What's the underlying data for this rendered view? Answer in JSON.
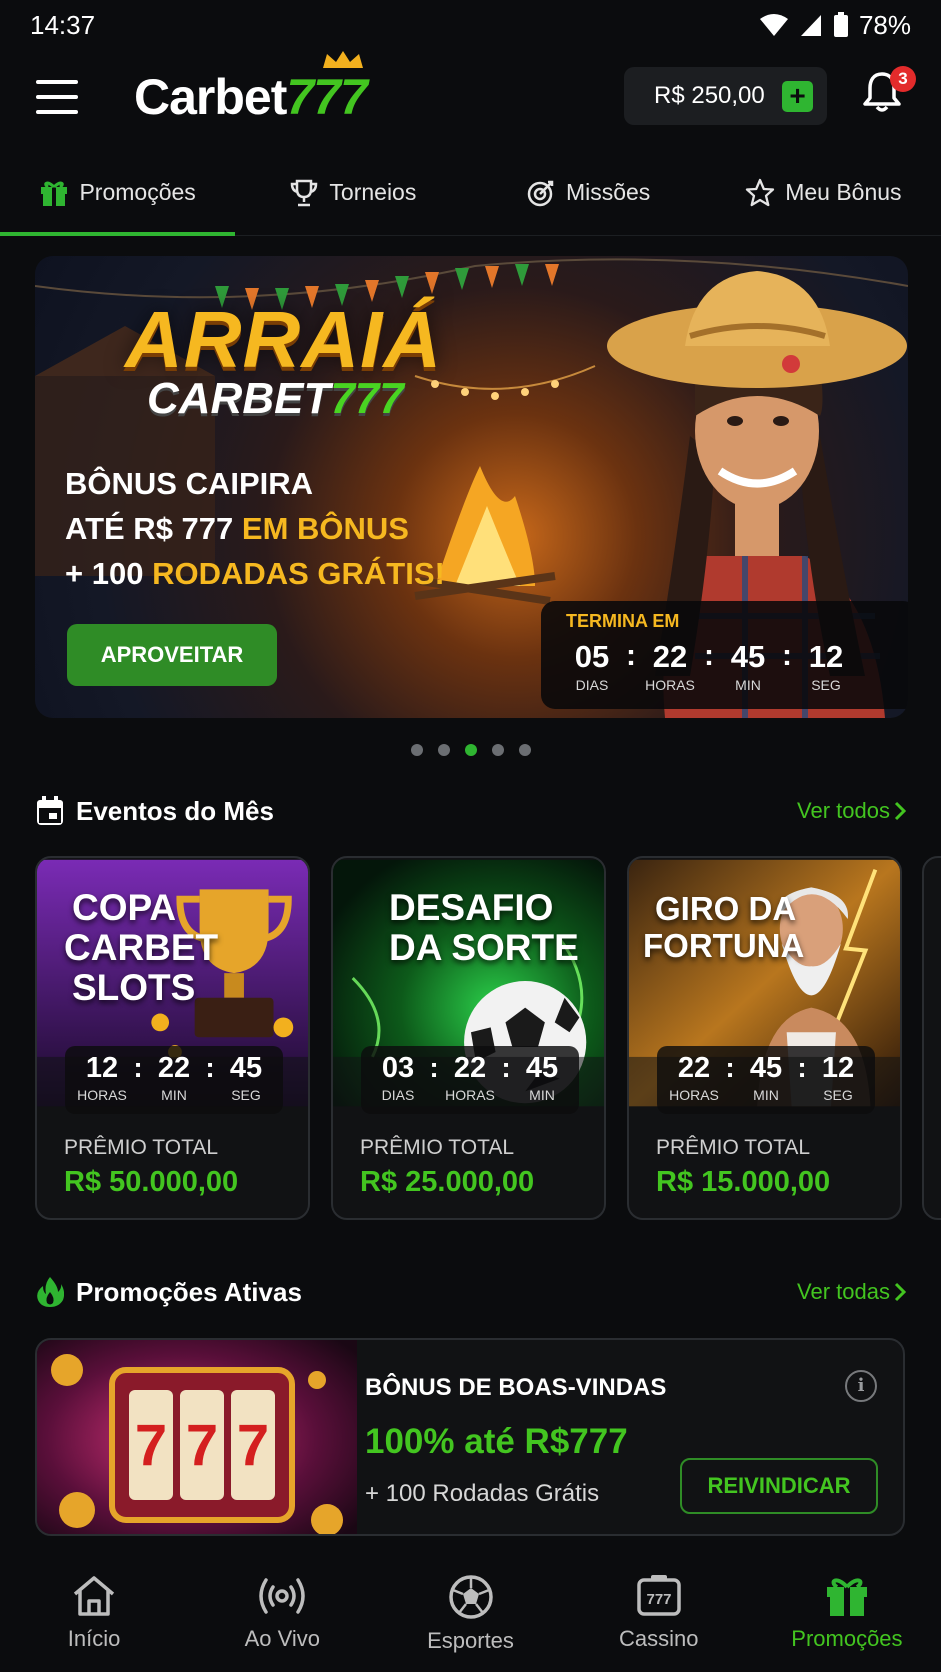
{
  "status_bar": {
    "time": "14:37",
    "battery": "78%"
  },
  "header": {
    "logo_word": "Carbet",
    "logo_num": "777",
    "balance": "R$ 250,00",
    "notification_count": "3"
  },
  "tabs": [
    {
      "label": "Promoções",
      "icon": "gift-icon",
      "active": true
    },
    {
      "label": "Torneios",
      "icon": "trophy-icon",
      "active": false
    },
    {
      "label": "Missões",
      "icon": "target-icon",
      "active": false
    },
    {
      "label": "Meu Bônus",
      "icon": "star-icon",
      "active": false
    }
  ],
  "banner": {
    "headline": "ARRAIÁ",
    "brand_word": "CARBET",
    "brand_num": "777",
    "line1": "BÔNUS CAIPIRA",
    "line2a": "ATÉ R$ 777 ",
    "line2b": "EM BÔNUS",
    "line3a": "+ 100 ",
    "line3b": "RODADAS GRÁTIS!",
    "cta": "APROVEITAR",
    "countdown": {
      "label": "TERMINA EM",
      "days": "05",
      "days_label": "DIAS",
      "hours": "22",
      "hours_label": "HORAS",
      "min": "45",
      "min_label": "MIN",
      "sec": "12",
      "sec_label": "SEG"
    },
    "slide_count": 5,
    "active_slide": 3
  },
  "events_section": {
    "title": "Eventos do Mês",
    "see_all": "Ver todos"
  },
  "events": [
    {
      "title_lines": [
        "COPA",
        "CARBET",
        "SLOTS"
      ],
      "timer": [
        {
          "value": "12",
          "unit": "HORAS"
        },
        {
          "value": "22",
          "unit": "MIN"
        },
        {
          "value": "45",
          "unit": "SEG"
        }
      ],
      "prize_label": "PRÊMIO TOTAL",
      "prize_value": "R$ 50.000,00"
    },
    {
      "title_lines": [
        "DESAFIO",
        "DA SORTE"
      ],
      "timer": [
        {
          "value": "03",
          "unit": "DIAS"
        },
        {
          "value": "22",
          "unit": "HORAS"
        },
        {
          "value": "45",
          "unit": "MIN"
        }
      ],
      "prize_label": "PRÊMIO TOTAL",
      "prize_value": "R$ 25.000,00"
    },
    {
      "title_lines": [
        "GIRO DA",
        "FORTUNA"
      ],
      "timer": [
        {
          "value": "22",
          "unit": "HORAS"
        },
        {
          "value": "45",
          "unit": "MIN"
        },
        {
          "value": "12",
          "unit": "SEG"
        }
      ],
      "prize_label": "PRÊMIO TOTAL",
      "prize_value": "R$ 15.000,00"
    }
  ],
  "promos_section": {
    "title": "Promoções Ativas",
    "see_all": "Ver todas"
  },
  "promo": {
    "title": "BÔNUS DE BOAS-VINDAS",
    "bonus": "100% até R$777",
    "sub": "+ 100 Rodadas Grátis",
    "reel": "777",
    "cta": "REIVINDICAR"
  },
  "bottom_nav": [
    {
      "label": "Início",
      "icon": "home-icon",
      "active": false
    },
    {
      "label": "Ao Vivo",
      "icon": "live-broadcast-icon",
      "active": false
    },
    {
      "label": "Esportes",
      "icon": "soccer-ball-icon",
      "active": false
    },
    {
      "label": "Cassino",
      "icon": "slot-machine-icon",
      "active": false
    },
    {
      "label": "Promoções",
      "icon": "gift-icon",
      "active": true
    }
  ],
  "colors": {
    "accent": "#2fb531",
    "accent_text": "#43c520",
    "gold": "#f6b820",
    "background": "#0b0c0e",
    "badge": "#e32b2b"
  }
}
